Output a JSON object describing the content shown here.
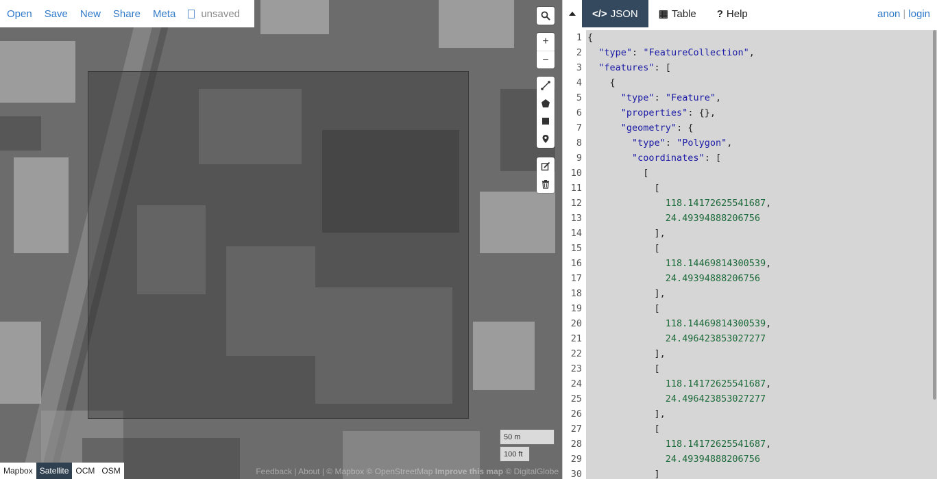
{
  "menu": {
    "open": "Open",
    "save": "Save",
    "new": "New",
    "share": "Share",
    "meta": "Meta",
    "unsaved": "unsaved"
  },
  "controls": {
    "zoom_in": "+",
    "zoom_out": "−"
  },
  "scale": {
    "metric": "50 m",
    "imperial": "100 ft"
  },
  "layers": [
    "Mapbox",
    "Satellite",
    "OCM",
    "OSM"
  ],
  "active_layer": "Satellite",
  "attribution": {
    "feedback": "Feedback",
    "about": "About",
    "mapbox": "© Mapbox",
    "osm": "© OpenStreetMap",
    "improve": "Improve this map",
    "digitalglobe": "© DigitalGlobe"
  },
  "pane": {
    "tabs": [
      {
        "icon": "</>",
        "label": "JSON"
      },
      {
        "icon": "▦",
        "label": "Table"
      },
      {
        "icon": "?",
        "label": "Help"
      }
    ],
    "active_tab": "JSON",
    "user": "anon",
    "login": "login"
  },
  "editor": {
    "lines": [
      "{",
      "  \"type\": \"FeatureCollection\",",
      "  \"features\": [",
      "    {",
      "      \"type\": \"Feature\",",
      "      \"properties\": {},",
      "      \"geometry\": {",
      "        \"type\": \"Polygon\",",
      "        \"coordinates\": [",
      "          [",
      "            [",
      "              118.14172625541687,",
      "              24.49394888206756",
      "            ],",
      "            [",
      "              118.14469814300539,",
      "              24.49394888206756",
      "            ],",
      "            [",
      "              118.14469814300539,",
      "              24.496423853027277",
      "            ],",
      "            [",
      "              118.14172625541687,",
      "              24.496423853027277",
      "            ],",
      "            [",
      "              118.14172625541687,",
      "              24.49394888206756",
      "            ]"
    ]
  },
  "colors": {
    "link": "#2f79c9",
    "tab_active": "#34495e",
    "editor_bg": "#d6d6d6",
    "json_key": "#1a1aa6",
    "json_number": "#1d6b3a"
  }
}
